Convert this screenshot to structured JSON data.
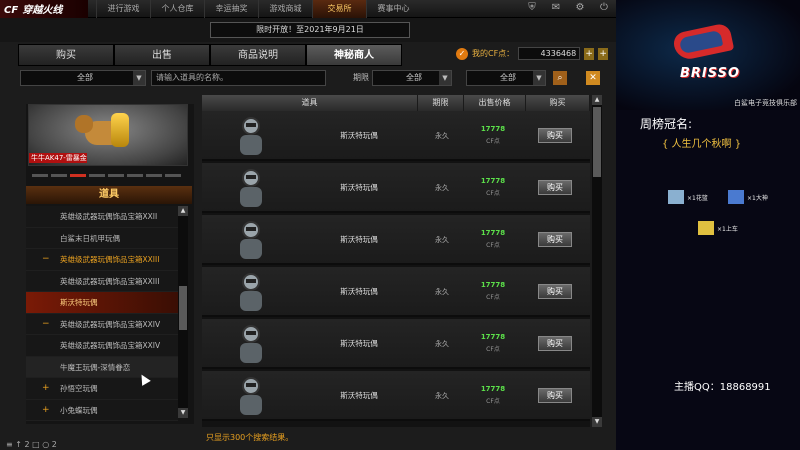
{
  "brand": {
    "logo": "CF",
    "logo_sub": "穿越火线"
  },
  "topnav": [
    "进行游戏",
    "个人仓库",
    "幸运抽奖",
    "游戏商城",
    "交易所",
    "赛事中心"
  ],
  "promo": "限时开放！至2021年9月21日",
  "tabs": [
    {
      "label": "购买",
      "active": false
    },
    {
      "label": "出售",
      "active": false
    },
    {
      "label": "商品说明",
      "active": false
    },
    {
      "label": "神秘商人",
      "active": true
    }
  ],
  "cp": {
    "label": "我的CF点：",
    "value": "4336468"
  },
  "filters": {
    "category": "全部",
    "search_placeholder": "请输入道具的名称。",
    "period_label": "期限",
    "period": "全部",
    "sort": "全部"
  },
  "preview": {
    "name": "牛牛AK47-雷暴金"
  },
  "left_header": "道具",
  "tree": [
    {
      "label": "英雄级武器玩偶饰品宝箱XXII",
      "mark": "",
      "style": ""
    },
    {
      "label": "白鲨末日机甲玩偶",
      "mark": "",
      "style": ""
    },
    {
      "label": "英雄级武器玩偶饰品宝箱XXIII",
      "mark": "−",
      "style": "orange"
    },
    {
      "label": "英雄级武器玩偶饰品宝箱XXIII",
      "mark": "",
      "style": ""
    },
    {
      "label": "斯沃特玩偶",
      "mark": "",
      "style": "sel-item"
    },
    {
      "label": "英雄级武器玩偶饰品宝箱XXIV",
      "mark": "−",
      "style": ""
    },
    {
      "label": "英雄级武器玩偶饰品宝箱XXIV",
      "mark": "",
      "style": ""
    },
    {
      "label": "牛魔王玩偶-深情眷恋",
      "mark": "",
      "style": "hl"
    },
    {
      "label": "孙悟空玩偶",
      "mark": "+",
      "style": ""
    },
    {
      "label": "小兔蝶玩偶",
      "mark": "+",
      "style": ""
    }
  ],
  "table": {
    "headers": [
      "道具",
      "期限",
      "出售价格",
      "购买"
    ],
    "rows": [
      {
        "name": "斯沃特玩偶",
        "period": "永久",
        "price": "17778",
        "currency": "CF点",
        "buy": "购买"
      },
      {
        "name": "斯沃特玩偶",
        "period": "永久",
        "price": "17778",
        "currency": "CF点",
        "buy": "购买"
      },
      {
        "name": "斯沃特玩偶",
        "period": "永久",
        "price": "17778",
        "currency": "CF点",
        "buy": "购买"
      },
      {
        "name": "斯沃特玩偶",
        "period": "永久",
        "price": "17778",
        "currency": "CF点",
        "buy": "购买"
      },
      {
        "name": "斯沃特玩偶",
        "period": "永久",
        "price": "17778",
        "currency": "CF点",
        "buy": "购买"
      },
      {
        "name": "斯沃特玩偶",
        "period": "永久",
        "price": "17778",
        "currency": "CF点",
        "buy": "购买"
      }
    ]
  },
  "footnote": "只显示300个搜索结果。",
  "bottom_left": "≡ ↑ 2 □ ○ 2",
  "stream": {
    "brand": "BRISSO",
    "club": "白鲨电子竞技俱乐部",
    "crown_title": "周榜冠名:",
    "crown_name": "{ 人生几个秋啊 }",
    "gifts": [
      "×1花篮",
      "×1大神",
      "×1上车"
    ],
    "qq": "主播QQ：18868991"
  }
}
